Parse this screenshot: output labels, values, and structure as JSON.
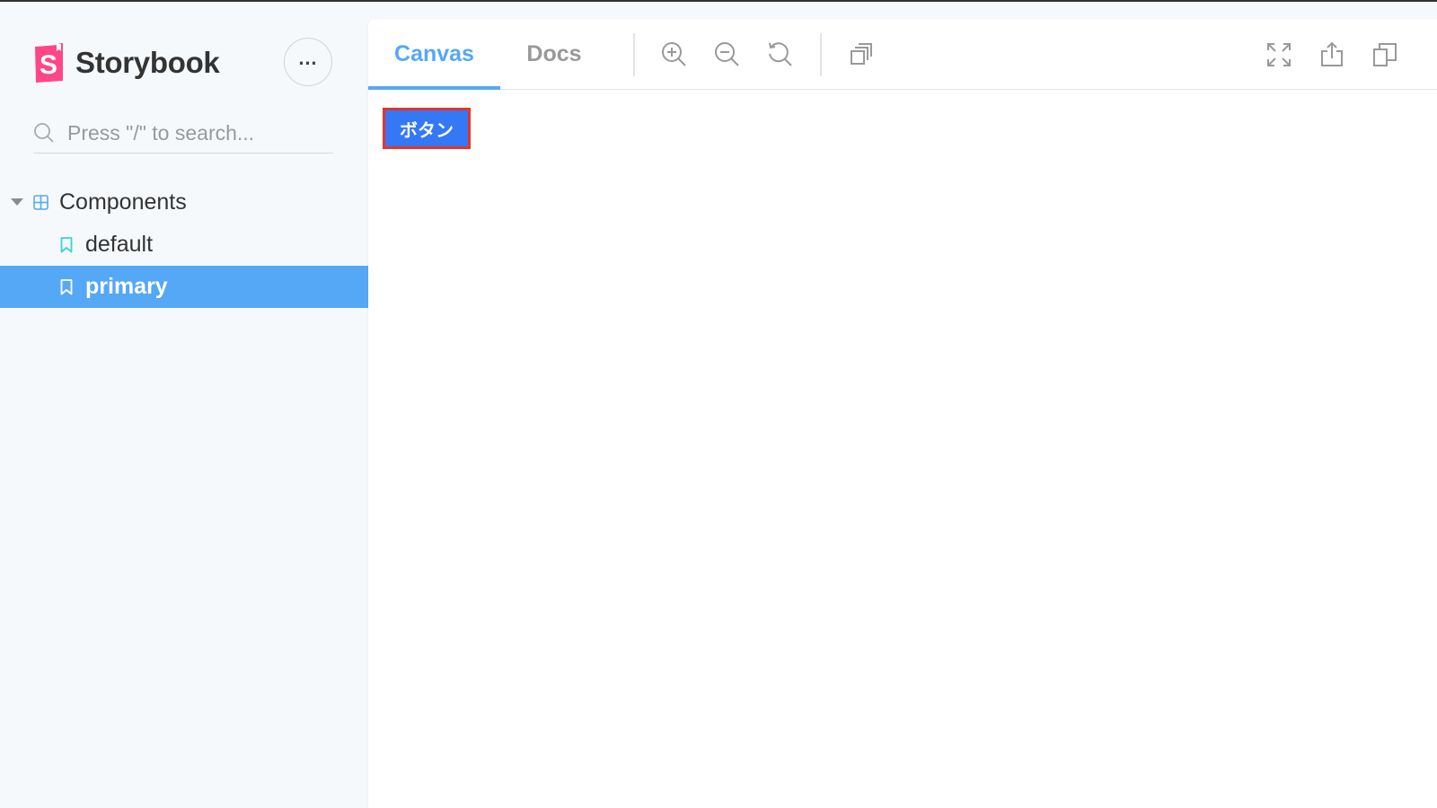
{
  "app": {
    "name": "Storybook",
    "brand_color": "#ff4785"
  },
  "sidebar": {
    "menu_icon": "ellipsis-icon",
    "search": {
      "placeholder": "Press \"/\" to search...",
      "icon": "search-icon"
    },
    "tree": [
      {
        "type": "group",
        "label": "Components",
        "expanded": true,
        "icon": "component-icon"
      },
      {
        "type": "story",
        "label": "default",
        "selected": false,
        "icon": "bookmark-icon"
      },
      {
        "type": "story",
        "label": "primary",
        "selected": true,
        "icon": "bookmark-icon"
      }
    ],
    "selected_color": "#55a8f5"
  },
  "toolbar": {
    "tabs": [
      {
        "label": "Canvas",
        "active": true
      },
      {
        "label": "Docs",
        "active": false
      }
    ],
    "tools": [
      "zoom-in-icon",
      "zoom-out-icon",
      "zoom-reset-icon",
      "background-icon"
    ],
    "right_tools": [
      "fullscreen-icon",
      "share-icon",
      "copy-icon"
    ],
    "accent_color": "#55a8f5"
  },
  "preview": {
    "button_label": "ボタン",
    "button_color": "#3478f6",
    "button_border_color": "#e5332a"
  }
}
